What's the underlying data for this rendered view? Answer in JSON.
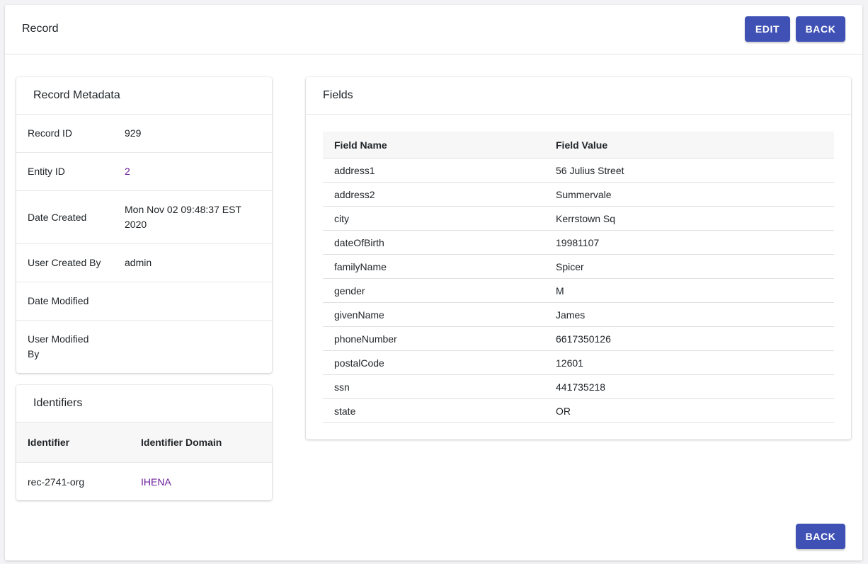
{
  "header": {
    "title": "Record",
    "edit_label": "EDIT",
    "back_label": "BACK"
  },
  "metadata": {
    "title": "Record Metadata",
    "rows": [
      {
        "label": "Record ID",
        "value": "929"
      },
      {
        "label": "Entity ID",
        "value": "2"
      },
      {
        "label": "Date Created",
        "value": "Mon Nov 02 09:48:37 EST 2020"
      },
      {
        "label": "User Created By",
        "value": "admin"
      },
      {
        "label": "Date Modified",
        "value": ""
      },
      {
        "label": "User Modified By",
        "value": ""
      }
    ]
  },
  "identifiers": {
    "title": "Identifiers",
    "columns": [
      "Identifier",
      "Identifier Domain"
    ],
    "rows": [
      {
        "identifier": "rec-2741-org",
        "domain": "IHENA"
      }
    ]
  },
  "fields": {
    "title": "Fields",
    "columns": [
      "Field Name",
      "Field Value"
    ],
    "rows": [
      {
        "name": "address1",
        "value": "56 Julius Street"
      },
      {
        "name": "address2",
        "value": "Summervale"
      },
      {
        "name": "city",
        "value": "Kerrstown Sq"
      },
      {
        "name": "dateOfBirth",
        "value": "19981107"
      },
      {
        "name": "familyName",
        "value": "Spicer"
      },
      {
        "name": "gender",
        "value": "M"
      },
      {
        "name": "givenName",
        "value": "James"
      },
      {
        "name": "phoneNumber",
        "value": "6617350126"
      },
      {
        "name": "postalCode",
        "value": "12601"
      },
      {
        "name": "ssn",
        "value": "441735218"
      },
      {
        "name": "state",
        "value": "OR"
      }
    ]
  },
  "footer": {
    "back_label": "BACK"
  },
  "colors": {
    "primary": "#3f51b5",
    "link": "#6a1b9a"
  }
}
